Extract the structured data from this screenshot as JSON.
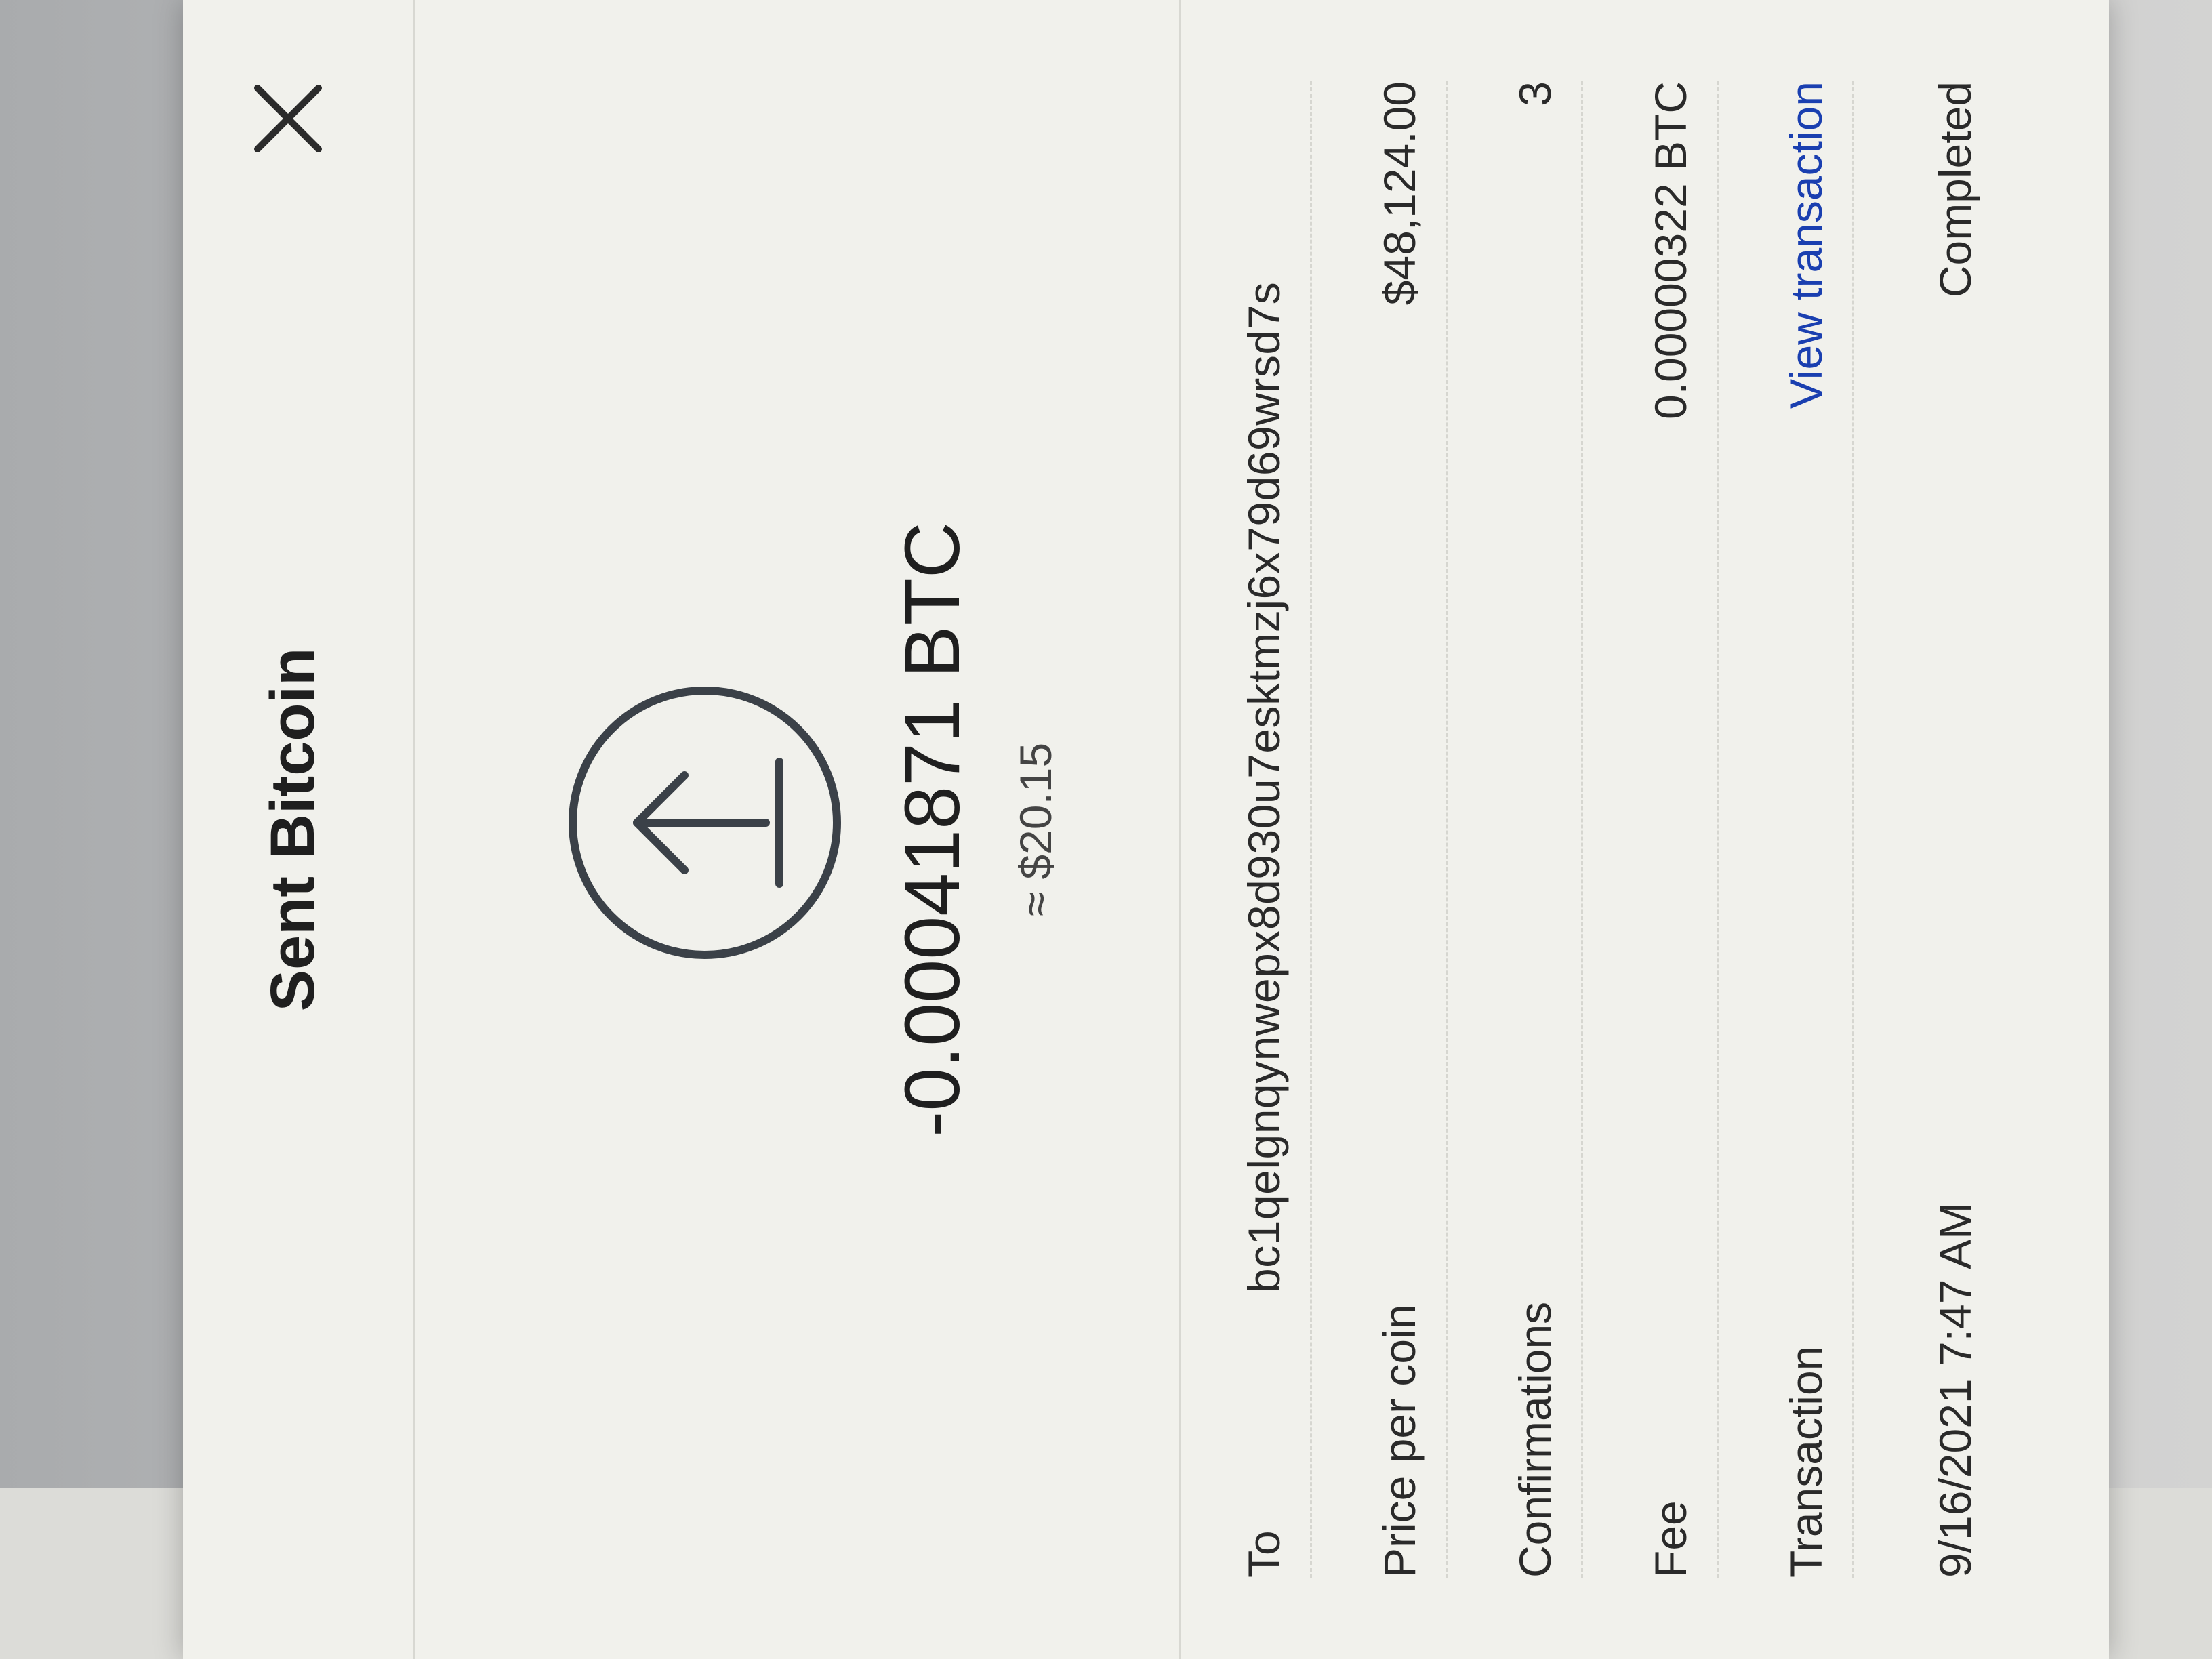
{
  "dialog": {
    "title": "Sent Bitcoin",
    "close_icon": "close-icon"
  },
  "summary": {
    "icon": "send-arrow-icon",
    "amount": "-0.00041871 BTC",
    "fiat_equivalent": "≈ $20.15"
  },
  "details": [
    {
      "label": "To",
      "value": "bc1qelgnqynwepx8d930u7esktmzj6x79d69wrsd7s"
    },
    {
      "label": "Price per coin",
      "value": "$48,124.00"
    },
    {
      "label": "Confirmations",
      "value": "3"
    },
    {
      "label": "Fee",
      "value": "0.00000322 BTC"
    },
    {
      "label": "Transaction",
      "value": "View transaction"
    },
    {
      "label": "9/16/2021 7:47 AM",
      "value": "Completed"
    }
  ],
  "background": {
    "edge_marks": [
      "$.",
      "$:",
      "$:",
      "$:"
    ]
  },
  "colors": {
    "link": "#1a3fb0",
    "dialog_bg": "#f1f1ec"
  }
}
